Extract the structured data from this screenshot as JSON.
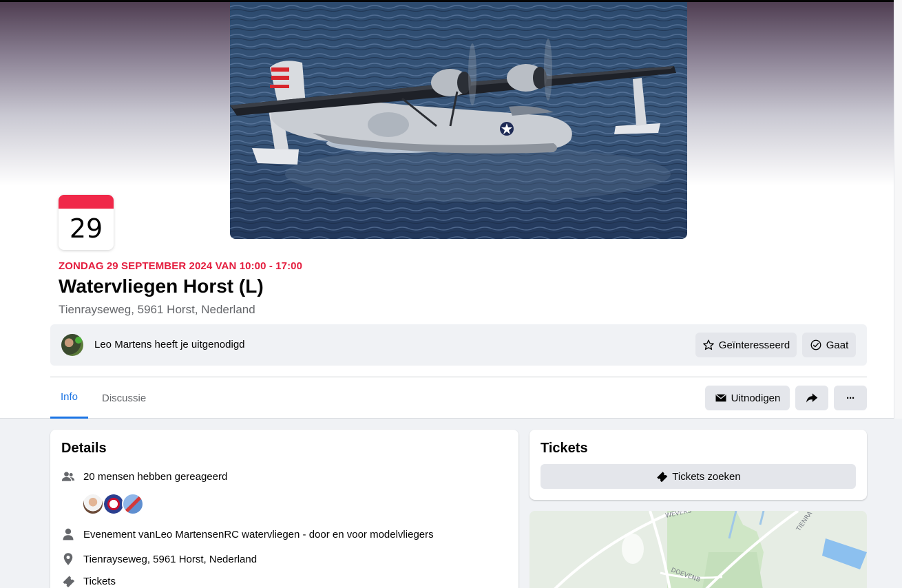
{
  "event": {
    "calendar_day": "29",
    "date_line": "ZONDAG 29 SEPTEMBER 2024 VAN 10:00 - 17:00",
    "title": "Watervliegen Horst (L)",
    "location": "Tienrayseweg, 5961 Horst, Nederland"
  },
  "invite": {
    "inviter": "Leo Martens",
    "text": " heeft je uitgenodigd",
    "interested_label": "Geïnteresseerd",
    "going_label": "Gaat"
  },
  "tabs": [
    {
      "label": "Info",
      "active": true
    },
    {
      "label": "Discussie",
      "active": false
    }
  ],
  "actions": {
    "invite_label": "Uitnodigen",
    "share_icon": "share-arrow-icon",
    "more_label": "···"
  },
  "details": {
    "title": "Details",
    "responded": "20 mensen hebben gereageerd",
    "host_prefix": "Evenement van ",
    "host_1": "Leo Martens",
    "host_joiner": " en ",
    "host_2": "RC watervliegen - door en voor modelvliegers",
    "address": "Tienrayseweg, 5961 Horst, Nederland",
    "tickets": "Tickets"
  },
  "tickets_card": {
    "title": "Tickets",
    "button_label": "Tickets zoeken"
  },
  "map": {
    "street_1": "WEVERS",
    "street_2": "TIENRA",
    "street_3": "DOEVENB"
  },
  "colors": {
    "accent": "#1b74e4",
    "date_red": "#e41e3f",
    "button_gray": "#e4e6eb",
    "page_bg": "#f0f2f5"
  }
}
